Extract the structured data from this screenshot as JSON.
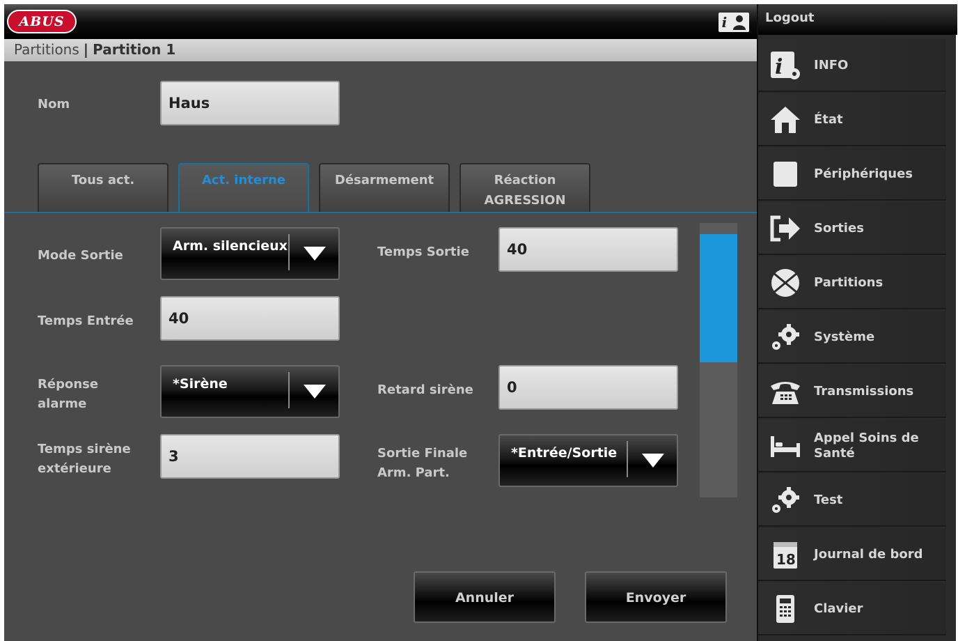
{
  "header": {
    "brand": "ABUS",
    "info_icon_char": "i"
  },
  "breadcrumb": {
    "parent": "Partitions",
    "separator": "|",
    "current": "Partition 1"
  },
  "form": {
    "nom_label": "Nom",
    "nom_value": "Haus",
    "tabs": [
      {
        "label": "Tous act."
      },
      {
        "label": "Act. interne"
      },
      {
        "label": "Désarmement"
      },
      {
        "label": "Réaction AGRESSION"
      }
    ],
    "active_tab": 1,
    "mode_sortie_label": "Mode Sortie",
    "mode_sortie_value": "Arm. silencieux",
    "temps_sortie_label": "Temps Sortie",
    "temps_sortie_value": "40",
    "temps_entree_label": "Temps Entrée",
    "temps_entree_value": "40",
    "reponse_alarme_label": "Réponse alarme",
    "reponse_alarme_value": "*Sirène",
    "retard_sirene_label": "Retard sirène",
    "retard_sirene_value": "0",
    "temps_sirene_ext_label": "Temps sirène extérieure",
    "temps_sirene_ext_value": "3",
    "sortie_finale_label": "Sortie Finale Arm. Part.",
    "sortie_finale_value": "*Entrée/Sortie"
  },
  "buttons": {
    "cancel": "Annuler",
    "send": "Envoyer"
  },
  "sidebar": {
    "logout": "Logout",
    "items": [
      {
        "label": "INFO",
        "icon": "info-gear-icon"
      },
      {
        "label": "État",
        "icon": "home-icon"
      },
      {
        "label": "Périphériques",
        "icon": "device-square-icon"
      },
      {
        "label": "Sorties",
        "icon": "output-arrow-icon"
      },
      {
        "label": "Partitions",
        "icon": "partition-pie-icon"
      },
      {
        "label": "Système",
        "icon": "gears-icon"
      },
      {
        "label": "Transmissions",
        "icon": "telephone-icon"
      },
      {
        "label": "Appel Soins de Santé",
        "icon": "bed-icon"
      },
      {
        "label": "Test",
        "icon": "gears-icon"
      },
      {
        "label": "Journal de bord",
        "icon": "calendar-icon"
      },
      {
        "label": "Clavier",
        "icon": "keypad-icon"
      }
    ],
    "calendar_day": "18"
  },
  "colors": {
    "accent": "#1d97dc",
    "panel": "#4a4a4a",
    "brand": "#c8102e"
  }
}
